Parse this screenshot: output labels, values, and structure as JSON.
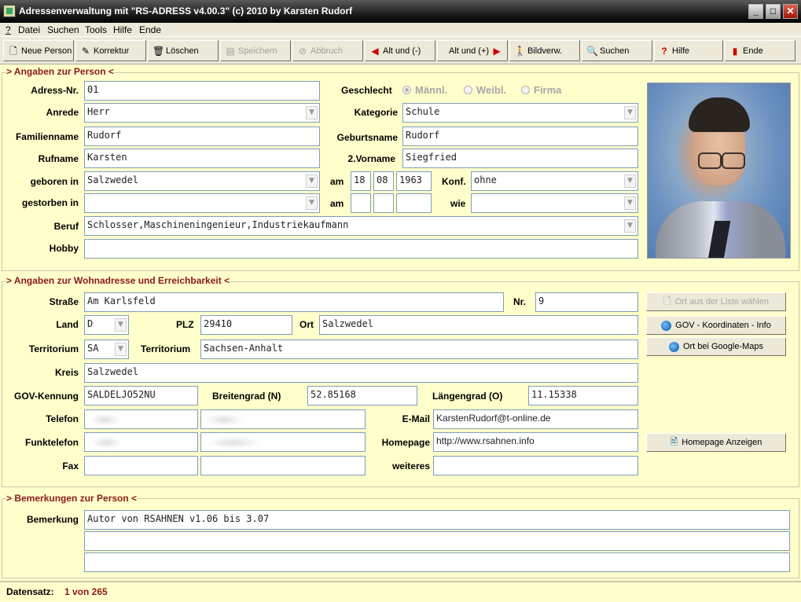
{
  "window": {
    "title": "Adressenverwaltung mit \"RS-ADRESS v4.00.3\" (c) 2010 by Karsten Rudorf"
  },
  "menu": {
    "help": "?",
    "datei": "Datei",
    "suchen": "Suchen",
    "tools": "Tools",
    "hilfe": "Hilfe",
    "ende": "Ende"
  },
  "toolbar": {
    "neue_person": "Neue Person",
    "korrektur": "Korrektur",
    "loeschen": "Löschen",
    "speichern": "Speichern",
    "abbruch": "Abbruch",
    "alt_minus": "Alt und (-)",
    "alt_plus": "Alt und (+)",
    "bildverw": "Bildverw.",
    "suchen": "Suchen",
    "hilfe": "Hilfe",
    "ende": "Ende"
  },
  "person": {
    "section_title": "> Angaben zur Person <",
    "labels": {
      "adress_nr": "Adress-Nr.",
      "anrede": "Anrede",
      "familienname": "Familienname",
      "rufname": "Rufname",
      "geboren_in": "geboren in",
      "gestorben_in": "gestorben in",
      "beruf": "Beruf",
      "hobby": "Hobby",
      "geschlecht": "Geschlecht",
      "kategorie": "Kategorie",
      "geburtsname": "Geburtsname",
      "vorname2": "2.Vorname",
      "am": "am",
      "am2": "am",
      "konf": "Konf.",
      "wie": "wie"
    },
    "gender": {
      "maennl": "Männl.",
      "weibl": "Weibl.",
      "firma": "Firma"
    },
    "values": {
      "adress_nr": "01",
      "anrede": "Herr",
      "familienname": "Rudorf",
      "rufname": "Karsten",
      "geboren_in": "Salzwedel",
      "gestorben_in": "",
      "beruf": "Schlosser,Maschineningenieur,Industriekaufmann",
      "hobby": "",
      "kategorie": "Schule",
      "geburtsname": "Rudorf",
      "vorname2": "Siegfried",
      "geb_tag": "18",
      "geb_monat": "08",
      "geb_jahr": "1963",
      "konf": "ohne",
      "tod_tag": "",
      "tod_monat": "",
      "tod_jahr": "",
      "wie": ""
    }
  },
  "address": {
    "section_title": "> Angaben zur Wohnadresse und Erreichbarkeit <",
    "labels": {
      "strasse": "Straße",
      "nr": "Nr.",
      "land": "Land",
      "plz": "PLZ",
      "ort": "Ort",
      "territorium1": "Territorium",
      "territorium2": "Territorium",
      "kreis": "Kreis",
      "gov": "GOV-Kennung",
      "breitengrad": "Breitengrad (N)",
      "laengengrad": "Längengrad (O)",
      "telefon": "Telefon",
      "email": "E-Mail",
      "funktelefon": "Funktelefon",
      "homepage": "Homepage",
      "fax": "Fax",
      "weiteres": "weiteres"
    },
    "values": {
      "strasse": "Am Karlsfeld",
      "nr": "9",
      "land": "D",
      "plz": "29410",
      "ort": "Salzwedel",
      "territorium_code": "SA",
      "territorium": "Sachsen-Anhalt",
      "kreis": "Salzwedel",
      "gov": "SALDELJO52NU",
      "breitengrad": "52.85168",
      "laengengrad": "11.15338",
      "email": "KarstenRudorf@t-online.de",
      "homepage": "http://www.rsahnen.info",
      "fax1": "",
      "fax2": "",
      "weiteres": ""
    },
    "buttons": {
      "ort_liste": "Ort aus der Liste wählen",
      "gov_info": "GOV - Koordinaten - Info",
      "google_maps": "Ort bei Google-Maps",
      "homepage": "Homepage Anzeigen"
    }
  },
  "remarks": {
    "section_title": "> Bemerkungen zur Person <",
    "label": "Bemerkung",
    "line1": "Autor von RSAHNEN v1.06 bis 3.07",
    "line2": "",
    "line3": ""
  },
  "status": {
    "label": "Datensatz:",
    "value": "1 von 265",
    "value_color": "#8B1A1A"
  },
  "colors": {
    "panel_bg": "#FFFFCC",
    "section_title": "#8B1A1A",
    "chrome": "#ECE9D8"
  }
}
